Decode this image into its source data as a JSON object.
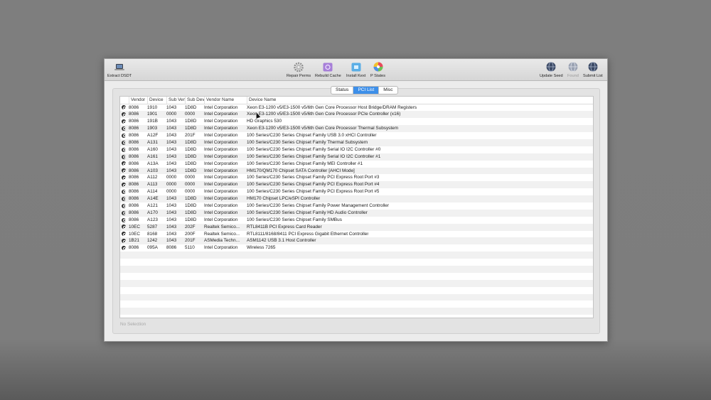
{
  "toolbar": {
    "left": [
      {
        "label": "Extract DSDT",
        "icon": "laptop-icon"
      }
    ],
    "center": [
      {
        "label": "Repair Perms",
        "icon": "gear-icon"
      },
      {
        "label": "Rebuild Cache",
        "icon": "cache-icon"
      },
      {
        "label": "Install Kext",
        "icon": "kext-icon"
      },
      {
        "label": "P States",
        "icon": "color-wheel-icon"
      }
    ],
    "right": [
      {
        "label": "Update Seed",
        "icon": "globe-icon"
      },
      {
        "label": "Found",
        "icon": "globe-icon"
      },
      {
        "label": "Submit List",
        "icon": "globe-icon"
      }
    ]
  },
  "tabs": [
    "Status",
    "PCI List",
    "Misc"
  ],
  "active_tab": "PCI List",
  "columns": [
    "",
    "Vendor",
    "Device",
    "Sub Ven",
    "Sub Dev",
    "Vendor Name",
    "Device Name"
  ],
  "rows": [
    [
      "8086",
      "1910",
      "1043",
      "1D8D",
      "Intel Corporation",
      "Xeon E3-1200 v5/E3-1500 v5/6th Gen Core Processor Host Bridge/DRAM Registers"
    ],
    [
      "8086",
      "1901",
      "0000",
      "0000",
      "Intel Corporation",
      "Xeon E3-1200 v5/E3-1500 v5/6th Gen Core Processor PCIe Controller (x16)"
    ],
    [
      "8086",
      "191B",
      "1043",
      "1D8D",
      "Intel Corporation",
      "HD Graphics 530"
    ],
    [
      "8086",
      "1903",
      "1043",
      "1D8D",
      "Intel Corporation",
      "Xeon E3-1200 v5/E3-1500 v5/6th Gen Core Processor Thermal Subsystem"
    ],
    [
      "8086",
      "A12F",
      "1043",
      "201F",
      "Intel Corporation",
      "100 Series/C230 Series Chipset Family USB 3.0 xHCI Controller"
    ],
    [
      "8086",
      "A131",
      "1043",
      "1D8D",
      "Intel Corporation",
      "100 Series/C230 Series Chipset Family Thermal Subsystem"
    ],
    [
      "8086",
      "A160",
      "1043",
      "1D8D",
      "Intel Corporation",
      "100 Series/C230 Series Chipset Family Serial IO I2C Controller #0"
    ],
    [
      "8086",
      "A161",
      "1043",
      "1D8D",
      "Intel Corporation",
      "100 Series/C230 Series Chipset Family Serial IO I2C Controller #1"
    ],
    [
      "8086",
      "A13A",
      "1043",
      "1D8D",
      "Intel Corporation",
      "100 Series/C230 Series Chipset Family MEI Controller #1"
    ],
    [
      "8086",
      "A103",
      "1043",
      "1D8D",
      "Intel Corporation",
      "HM170/QM170 Chipset SATA Controller [AHCI Mode]"
    ],
    [
      "8086",
      "A112",
      "0000",
      "0000",
      "Intel Corporation",
      "100 Series/C230 Series Chipset Family PCI Express Root Port #3"
    ],
    [
      "8086",
      "A113",
      "0000",
      "0000",
      "Intel Corporation",
      "100 Series/C230 Series Chipset Family PCI Express Root Port #4"
    ],
    [
      "8086",
      "A114",
      "0000",
      "0000",
      "Intel Corporation",
      "100 Series/C230 Series Chipset Family PCI Express Root Port #5"
    ],
    [
      "8086",
      "A14E",
      "1043",
      "1D8D",
      "Intel Corporation",
      "HM170 Chipset LPC/eSPI Controller"
    ],
    [
      "8086",
      "A121",
      "1043",
      "1D8D",
      "Intel Corporation",
      "100 Series/C230 Series Chipset Family Power Management Controller"
    ],
    [
      "8086",
      "A170",
      "1043",
      "1D8D",
      "Intel Corporation",
      "100 Series/C230 Series Chipset Family HD Audio Controller"
    ],
    [
      "8086",
      "A123",
      "1043",
      "1D8D",
      "Intel Corporation",
      "100 Series/C230 Series Chipset Family SMBus"
    ],
    [
      "10EC",
      "5287",
      "1043",
      "202F",
      "Realtek Semico...",
      "RTL8411B PCI Express Card Reader"
    ],
    [
      "10EC",
      "8168",
      "1043",
      "200F",
      "Realtek Semico...",
      "RTL8111/8168/8411 PCI Express Gigabit Ethernet Controller"
    ],
    [
      "1B21",
      "1242",
      "1043",
      "201F",
      "ASMedia Techn...",
      "ASM1142 USB 3.1 Host Controller"
    ],
    [
      "8086",
      "095A",
      "8086",
      "5110",
      "Intel Corporation",
      "Wireless 7265"
    ]
  ],
  "status_text": "No Selection",
  "colors": {
    "accent": "#3d8fe9"
  }
}
